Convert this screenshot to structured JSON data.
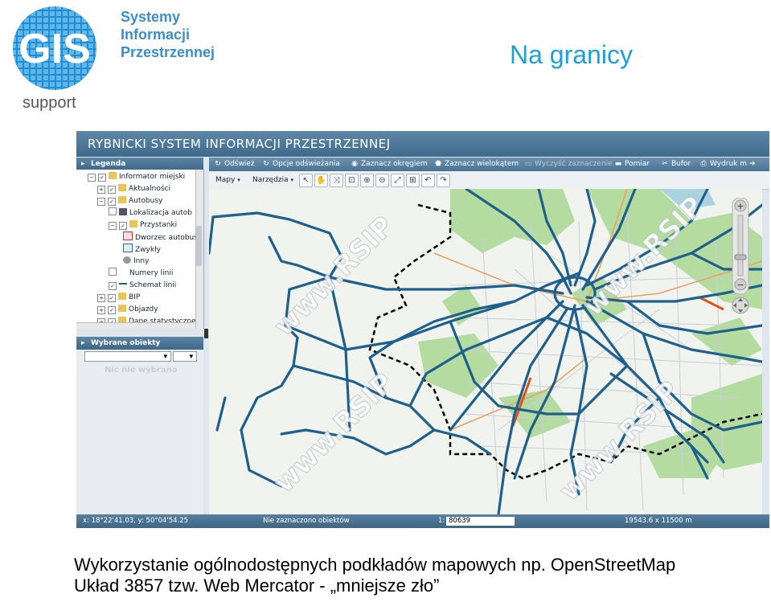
{
  "slide": {
    "logo_text": "GIS",
    "logo_sub": "support",
    "org_line1": "Systemy",
    "org_line2": "Informacji",
    "org_line3": "Przestrzennej",
    "title": "Na granicy",
    "caption_line1": "Wykorzystanie ogólnodostępnych podkładów mapowych np. OpenStreetMap",
    "caption_line2": "Układ 3857 tzw. Web Mercator - „mniejsze zło”"
  },
  "app": {
    "title": "RYBNICKI SYSTEM INFORMACJI PRZESTRZENNEJ",
    "legend_header": "Legenda",
    "selected_header": "Wybrane obiekty",
    "nothing_selected": "Nic nie wybrano",
    "tree": [
      {
        "label": "Informator miejski",
        "indent": 1
      },
      {
        "label": "Aktualności",
        "indent": 2
      },
      {
        "label": "Autobusy",
        "indent": 2
      },
      {
        "label": "Lokalizacja autob",
        "indent": 3
      },
      {
        "label": "Przystanki",
        "indent": 3
      },
      {
        "label": "Dworzec autobus",
        "indent": 4
      },
      {
        "label": "Zwykły",
        "indent": 4
      },
      {
        "label": "Inny",
        "indent": 4
      },
      {
        "label": "Numery linii",
        "indent": 3
      },
      {
        "label": "Schemat linii",
        "indent": 3
      },
      {
        "label": "BIP",
        "indent": 2
      },
      {
        "label": "Objazdy",
        "indent": 2
      },
      {
        "label": "Dane statystyczne",
        "indent": 2
      }
    ],
    "toolbar": {
      "refresh": "Odśwież",
      "refresh_options": "Opcje odświeżania",
      "select_circle": "Zaznacz okręgiem",
      "select_polygon": "Zaznacz wielokątem",
      "clear_selection": "Wyczyść zaznaczenie",
      "measure": "Pomiar",
      "buffer": "Bufor",
      "print": "Wydruk m"
    },
    "menu": {
      "maps": "Mapy",
      "tools": "Narzędzia"
    },
    "watermark": "www.RSIP",
    "status": {
      "coords": "x: 18°22'41.03, y: 50°04'54.25",
      "selection": "Nie zaznaczono obiektów",
      "scale_prefix": "1:",
      "scale_value": "80639",
      "extent": "19543.6 x 11500 m"
    }
  },
  "colors": {
    "route": "#1f5f8b",
    "green": "#b5dca0",
    "boundary": "#000000",
    "accent": "#3a8fc8"
  }
}
